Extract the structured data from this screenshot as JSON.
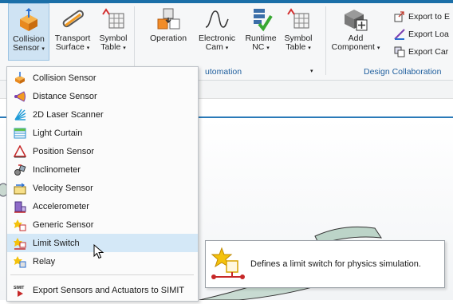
{
  "ribbon": {
    "buttons": [
      {
        "line1": "Collision",
        "line2": "Sensor",
        "caret": "▾"
      },
      {
        "line1": "Transport",
        "line2": "Surface",
        "caret": "▾"
      },
      {
        "line1": "Symbol",
        "line2": "Table",
        "caret": "▾"
      },
      {
        "line1": "Operation",
        "line2": "",
        "caret": ""
      },
      {
        "line1": "Electronic",
        "line2": "Cam",
        "caret": "▾"
      },
      {
        "line1": "Runtime",
        "line2": "NC",
        "caret": "▾"
      },
      {
        "line1": "Symbol",
        "line2": "Table",
        "caret": "▾"
      },
      {
        "line1": "Add",
        "line2": "Component",
        "caret": "▾"
      }
    ],
    "group_automation": "utomation",
    "group_design": "Design Collaboration",
    "export_items": [
      "Export to E",
      "Export Loa",
      "Export Car"
    ]
  },
  "menu": {
    "items": [
      "Collision Sensor",
      "Distance Sensor",
      "2D Laser Scanner",
      "Light Curtain",
      "Position Sensor",
      "Inclinometer",
      "Velocity Sensor",
      "Accelerometer",
      "Generic Sensor",
      "Limit Switch",
      "Relay",
      "Export Sensors and Actuators to SIMIT"
    ]
  },
  "tooltip": {
    "text": "Defines a limit switch for physics simulation."
  },
  "colors": {
    "accent": "#1b6fa8",
    "menu_hover": "#d4e8f7",
    "group_label": "#1f5f9e"
  }
}
